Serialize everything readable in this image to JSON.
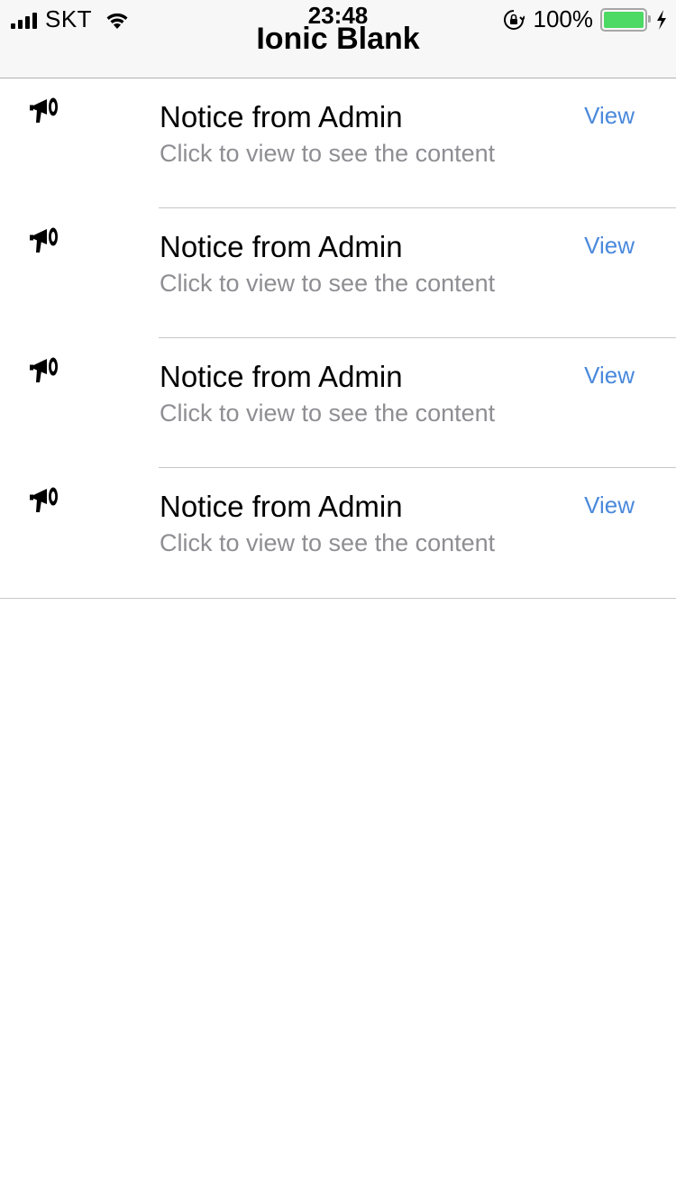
{
  "status_bar": {
    "carrier": "SKT",
    "time": "23:48",
    "battery_percent": "100%",
    "battery_level": 1.0,
    "signal_icon": "cellular-signal-icon",
    "wifi_icon": "wifi-icon",
    "rotation_lock_icon": "rotation-lock-icon",
    "charging_icon": "charging-bolt-icon",
    "battery_color": "#4cd964"
  },
  "header": {
    "title": "Ionic Blank"
  },
  "notices": {
    "icon": "megaphone-icon",
    "action_color": "#4a89dc",
    "items": [
      {
        "title": "Notice from Admin",
        "description": "Click to view to see the content",
        "action": "View"
      },
      {
        "title": "Notice from Admin",
        "description": "Click to view to see the content",
        "action": "View"
      },
      {
        "title": "Notice from Admin",
        "description": "Click to view to see the content",
        "action": "View"
      },
      {
        "title": "Notice from Admin",
        "description": "Click to view to see the content",
        "action": "View"
      }
    ]
  }
}
